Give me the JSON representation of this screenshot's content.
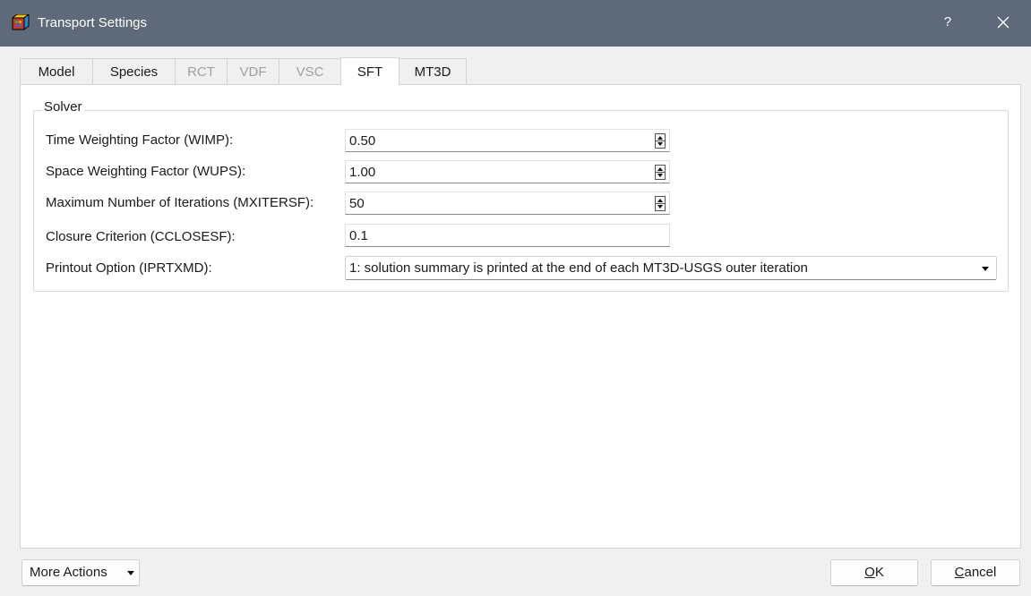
{
  "window": {
    "title": "Transport Settings",
    "help_label": "?",
    "icon": "app-cube-icon",
    "titlebar_color": "#5e6a7a"
  },
  "tabs": [
    {
      "label": "Model",
      "state": "normal"
    },
    {
      "label": "Species",
      "state": "normal"
    },
    {
      "label": "RCT",
      "state": "disabled"
    },
    {
      "label": "VDF",
      "state": "disabled"
    },
    {
      "label": "VSC",
      "state": "disabled"
    },
    {
      "label": "SFT",
      "state": "active"
    },
    {
      "label": "MT3D",
      "state": "normal"
    }
  ],
  "solver": {
    "group_title": "Solver",
    "fields": [
      {
        "label": "Time Weighting Factor (WIMP):",
        "value": "0.50",
        "control": "spinbox"
      },
      {
        "label": "Space Weighting Factor (WUPS):",
        "value": "1.00",
        "control": "spinbox"
      },
      {
        "label": "Maximum Number of Iterations (MXITERSF):",
        "value": "50",
        "control": "spinbox"
      },
      {
        "label": "Closure Criterion (CCLOSESF):",
        "value": "0.1",
        "control": "text"
      },
      {
        "label": "Printout Option (IPRTXMD):",
        "value": "1: solution summary is printed at the end of each MT3D-USGS outer iteration",
        "control": "dropdown"
      }
    ]
  },
  "footer": {
    "more_actions_label": "More Actions",
    "ok_label": "OK",
    "ok_mnemonic": "O",
    "ok_rest": "K",
    "cancel_label": "Cancel",
    "cancel_mnemonic": "C",
    "cancel_rest": "ancel"
  }
}
